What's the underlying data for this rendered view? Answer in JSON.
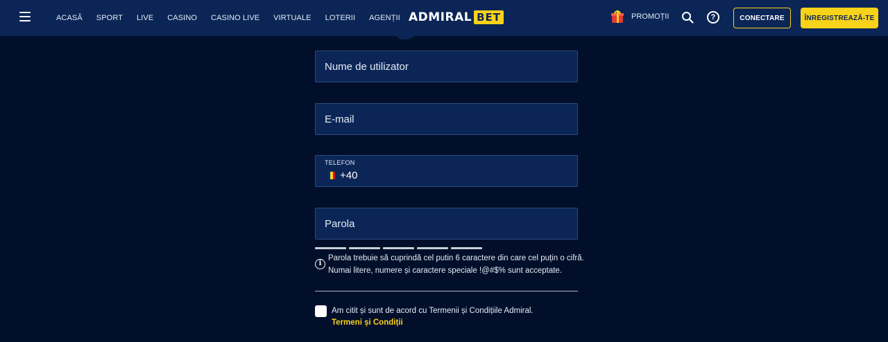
{
  "header": {
    "nav": [
      "ACASĂ",
      "SPORT",
      "LIVE",
      "CASINO",
      "CASINO LIVE",
      "VIRTUALE",
      "LOTERII",
      "AGENȚII"
    ],
    "logo": {
      "part1": "ADMIRAL",
      "part2": "BET"
    },
    "promo_label": "PROMOȚII",
    "login_label": "CONECTARE",
    "register_label": "ÎNREGISTREAZĂ-TE"
  },
  "form": {
    "username_placeholder": "Nume de utilizator",
    "email_placeholder": "E-mail",
    "phone": {
      "label": "TELEFON",
      "prefix": "+40",
      "flag_colors": [
        "#002b7f",
        "#fcd116",
        "#ce1126"
      ]
    },
    "password_placeholder": "Parola",
    "password_strength_segments": 5,
    "password_hint_line1": "Parola trebuie să cuprindă cel putin 6 caractere din care cel puțin o cifră.",
    "password_hint_line2": "Numai litere, numere și caractere speciale !@#$% sunt acceptate.",
    "terms_text": "Am citit și sunt de acord cu Termenii și Condițiile Admiral.",
    "terms_link": "Termeni și Condiții"
  },
  "colors": {
    "accent": "#f9d21a",
    "header_bg": "#0b2656",
    "page_bg": "#020f2a"
  },
  "icons": [
    "hamburger-menu-icon",
    "gift-icon",
    "search-icon",
    "help-icon",
    "info-icon"
  ]
}
